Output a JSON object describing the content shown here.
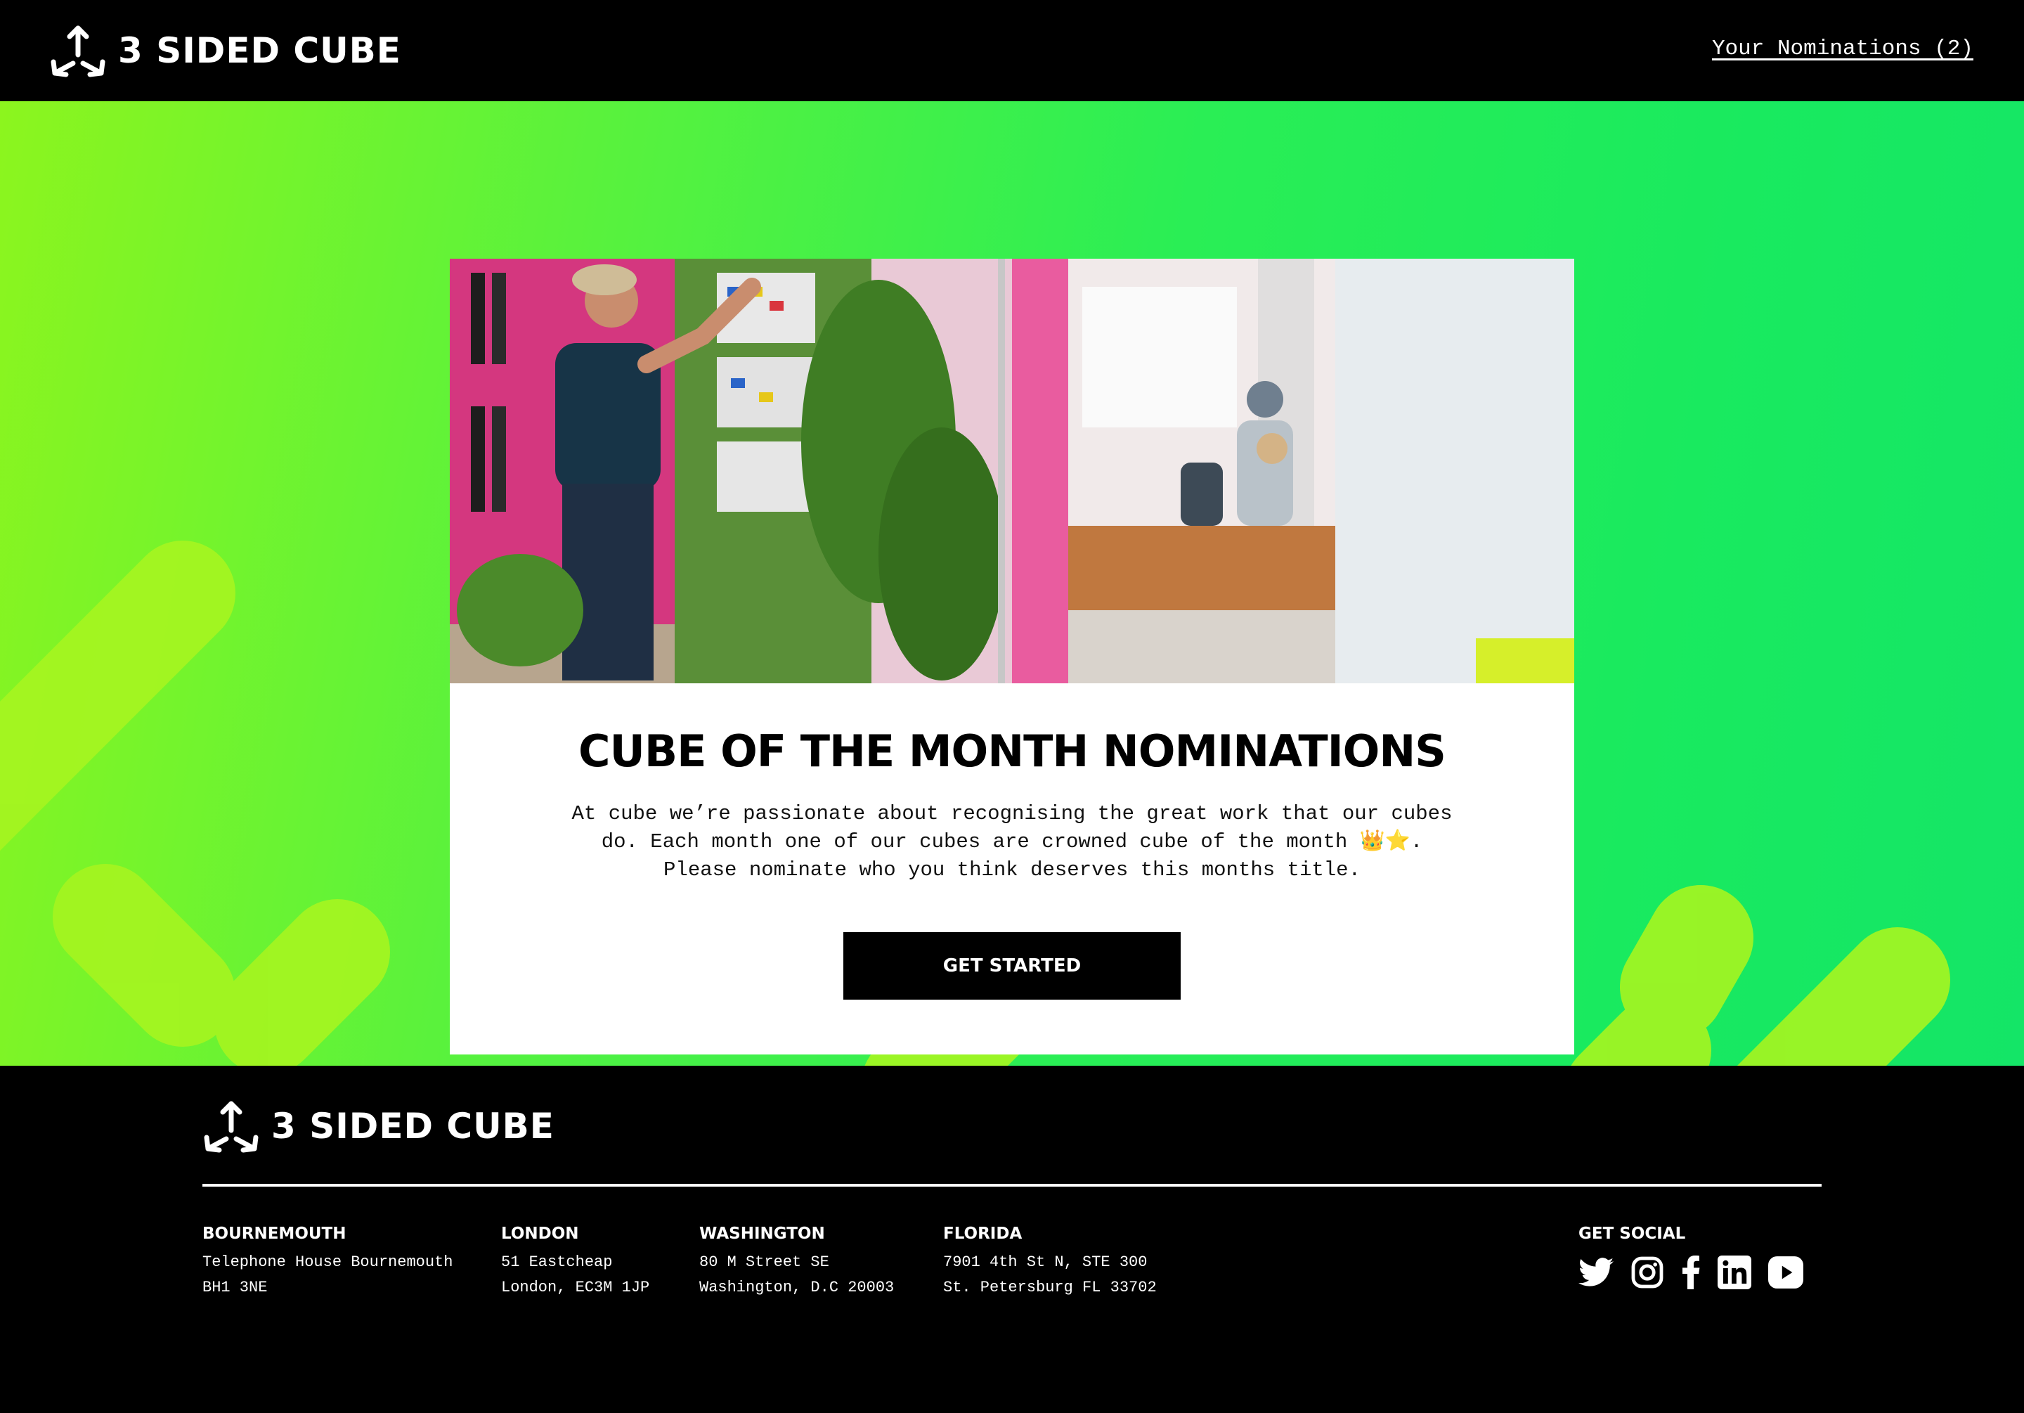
{
  "brand": {
    "name": "3 SIDED CUBE"
  },
  "header": {
    "nominations_link": "Your Nominations (2)"
  },
  "card": {
    "title": "CUBE OF THE MONTH NOMINATIONS",
    "description_line1": "At cube we’re passionate about recognising the great work that our cubes",
    "description_line2": "do. Each month one of our cubes are crowned cube of the month 👑⭐.",
    "description_line3": "Please nominate who you think deserves this months title.",
    "cta_label": "GET STARTED"
  },
  "footer": {
    "offices": [
      {
        "city": "BOURNEMOUTH",
        "line1": "Telephone House Bournemouth",
        "line2": "BH1 3NE"
      },
      {
        "city": "LONDON",
        "line1": "51 Eastcheap",
        "line2": "London, EC3M 1JP"
      },
      {
        "city": "WASHINGTON",
        "line1": "80 M Street SE",
        "line2": "Washington, D.C 20003"
      },
      {
        "city": "FLORIDA",
        "line1": "7901 4th St N, STE 300",
        "line2": "St. Petersburg FL 33702"
      }
    ],
    "social_title": "GET SOCIAL",
    "social_icons": [
      "twitter-icon",
      "instagram-icon",
      "facebook-icon",
      "linkedin-icon",
      "youtube-icon"
    ]
  },
  "colors": {
    "header_bg": "#000000",
    "hero_gradient_start": "#8cf51e",
    "hero_gradient_end": "#14e567",
    "accent_lime": "#a6f520",
    "card_bg": "#ffffff",
    "button_bg": "#000000"
  }
}
